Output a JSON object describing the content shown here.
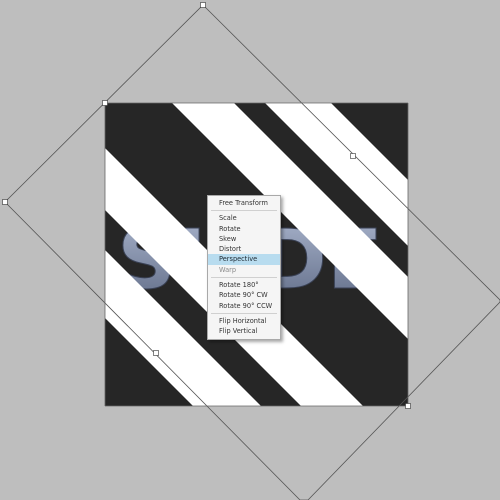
{
  "canvas": {
    "background": "#bebebe",
    "artwork_dark": "#262626",
    "artwork_light": "#ffffff",
    "text_fill": "#7d8aa6",
    "watermark_text": "SLIDE"
  },
  "context_menu": {
    "highlight_color": "#b8dcef",
    "groups": [
      [
        {
          "label": "Free Transform",
          "disabled": false
        }
      ],
      [
        {
          "label": "Scale",
          "disabled": false
        },
        {
          "label": "Rotate",
          "disabled": false
        },
        {
          "label": "Skew",
          "disabled": false
        },
        {
          "label": "Distort",
          "disabled": false
        },
        {
          "label": "Perspective",
          "disabled": false,
          "highlighted": true
        },
        {
          "label": "Warp",
          "disabled": true
        }
      ],
      [
        {
          "label": "Rotate 180°",
          "disabled": false
        },
        {
          "label": "Rotate 90° CW",
          "disabled": false
        },
        {
          "label": "Rotate 90° CCW",
          "disabled": false
        }
      ],
      [
        {
          "label": "Flip Horizontal",
          "disabled": false
        },
        {
          "label": "Flip Vertical",
          "disabled": false
        }
      ]
    ]
  }
}
